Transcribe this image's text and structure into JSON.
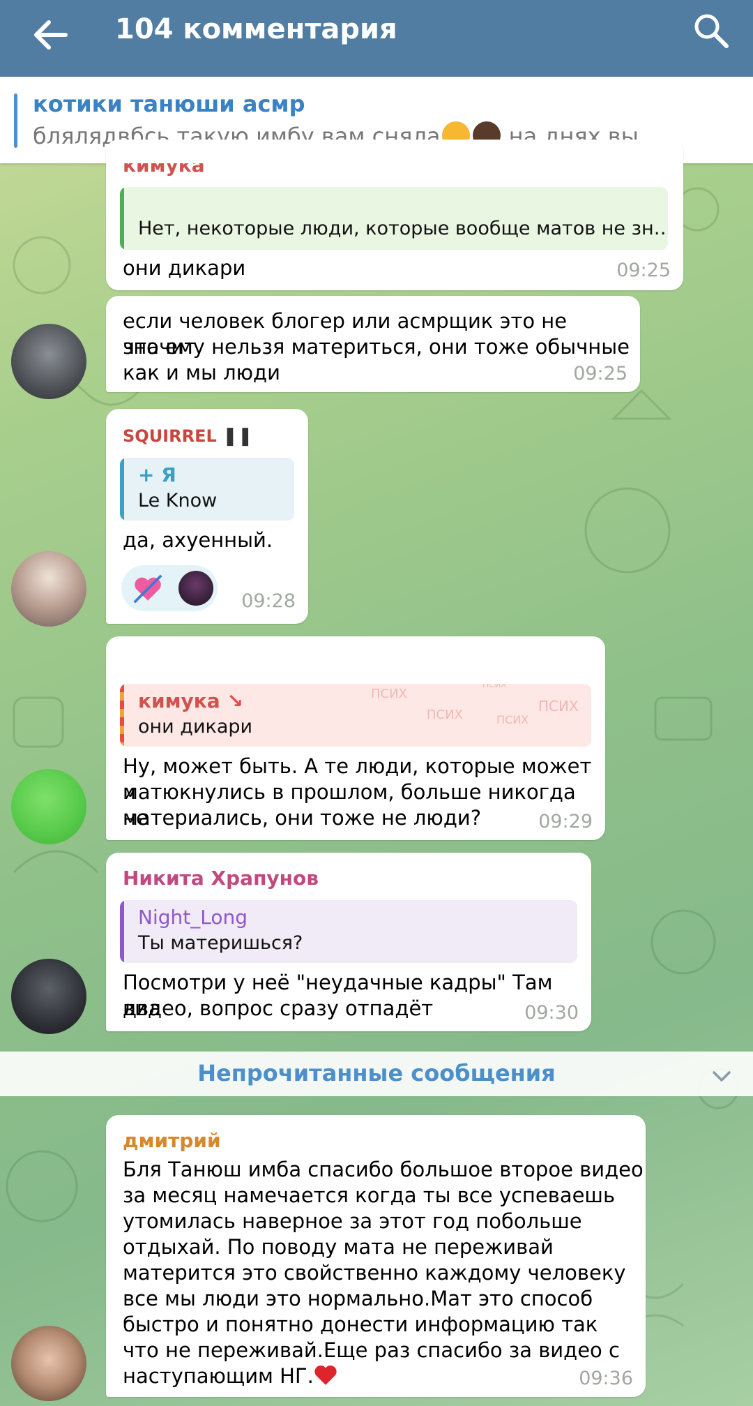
{
  "header": {
    "title": "104 комментария"
  },
  "pinned": {
    "channel": "котики танюши асмр",
    "preview_before": "блялядвбсь такую имбу вам сняла",
    "preview_after": "на днях вы…"
  },
  "messages": [
    {
      "sender": "кимука",
      "reply_text": "Нет, некоторые люди, которые вообще матов не зн…",
      "text": "они дикари",
      "time": "09:25"
    },
    {
      "text_lines": [
        "если человек блогер или асмрщик это не значит",
        "что ему нельзя материться, они тоже обычные",
        "как и мы люди"
      ],
      "time": "09:25"
    },
    {
      "sender": "SQUIRREL",
      "reply_name": "+ Я",
      "reply_text": "Le Know",
      "text": "да, ахуенный.",
      "time": "09:28"
    },
    {
      "reply_name": "кимука",
      "reply_text": "они дикари",
      "reply_watermarks": [
        "ПСИХ",
        "ПСИХ",
        "ПСИХ",
        "ПСИХ",
        "ПСИХ"
      ],
      "text_lines": [
        "Ну, может быть. А те люди, которые может и",
        "матюкнулись в прошлом, больше никогда не",
        "материались, они тоже не люди?"
      ],
      "time": "09:29"
    },
    {
      "sender": "Никита Храпунов",
      "reply_name": "Night_Long",
      "reply_text": "Ты материшься?",
      "text_lines": [
        "Посмотри у неё \"неудачные кадры\" Там два",
        "видео, вопрос сразу отпадёт"
      ],
      "time": "09:30"
    },
    {
      "sender": "дмитрий",
      "text_lines": [
        "Бля Танюш имба спасибо большое второе видео",
        "за месяц намечается когда ты все успеваешь",
        "утомилась наверное за этот год побольше",
        "отдыхай. По поводу мата не переживай",
        "матерится это свойственно каждому человеку",
        "все мы люди это нормально.Мат это способ",
        "быстро и понятно донести информацию так",
        "что не переживай.Еще раз спасибо за видео с",
        "наступающим НГ."
      ],
      "time": "09:36"
    }
  ],
  "unread_divider": "Непрочитанные сообщения",
  "colors": {
    "header_bg": "#517da2",
    "sender_kimuka": "#d0524f",
    "sender_squirrel": "#c8463f",
    "sender_nikita": "#c0497f",
    "sender_dmitriy": "#d8882c",
    "reply_green": "#4caf50",
    "reply_blue": "#3aa0c8",
    "reply_purple": "#8e58c9",
    "unread_label": "#4d8fca"
  }
}
